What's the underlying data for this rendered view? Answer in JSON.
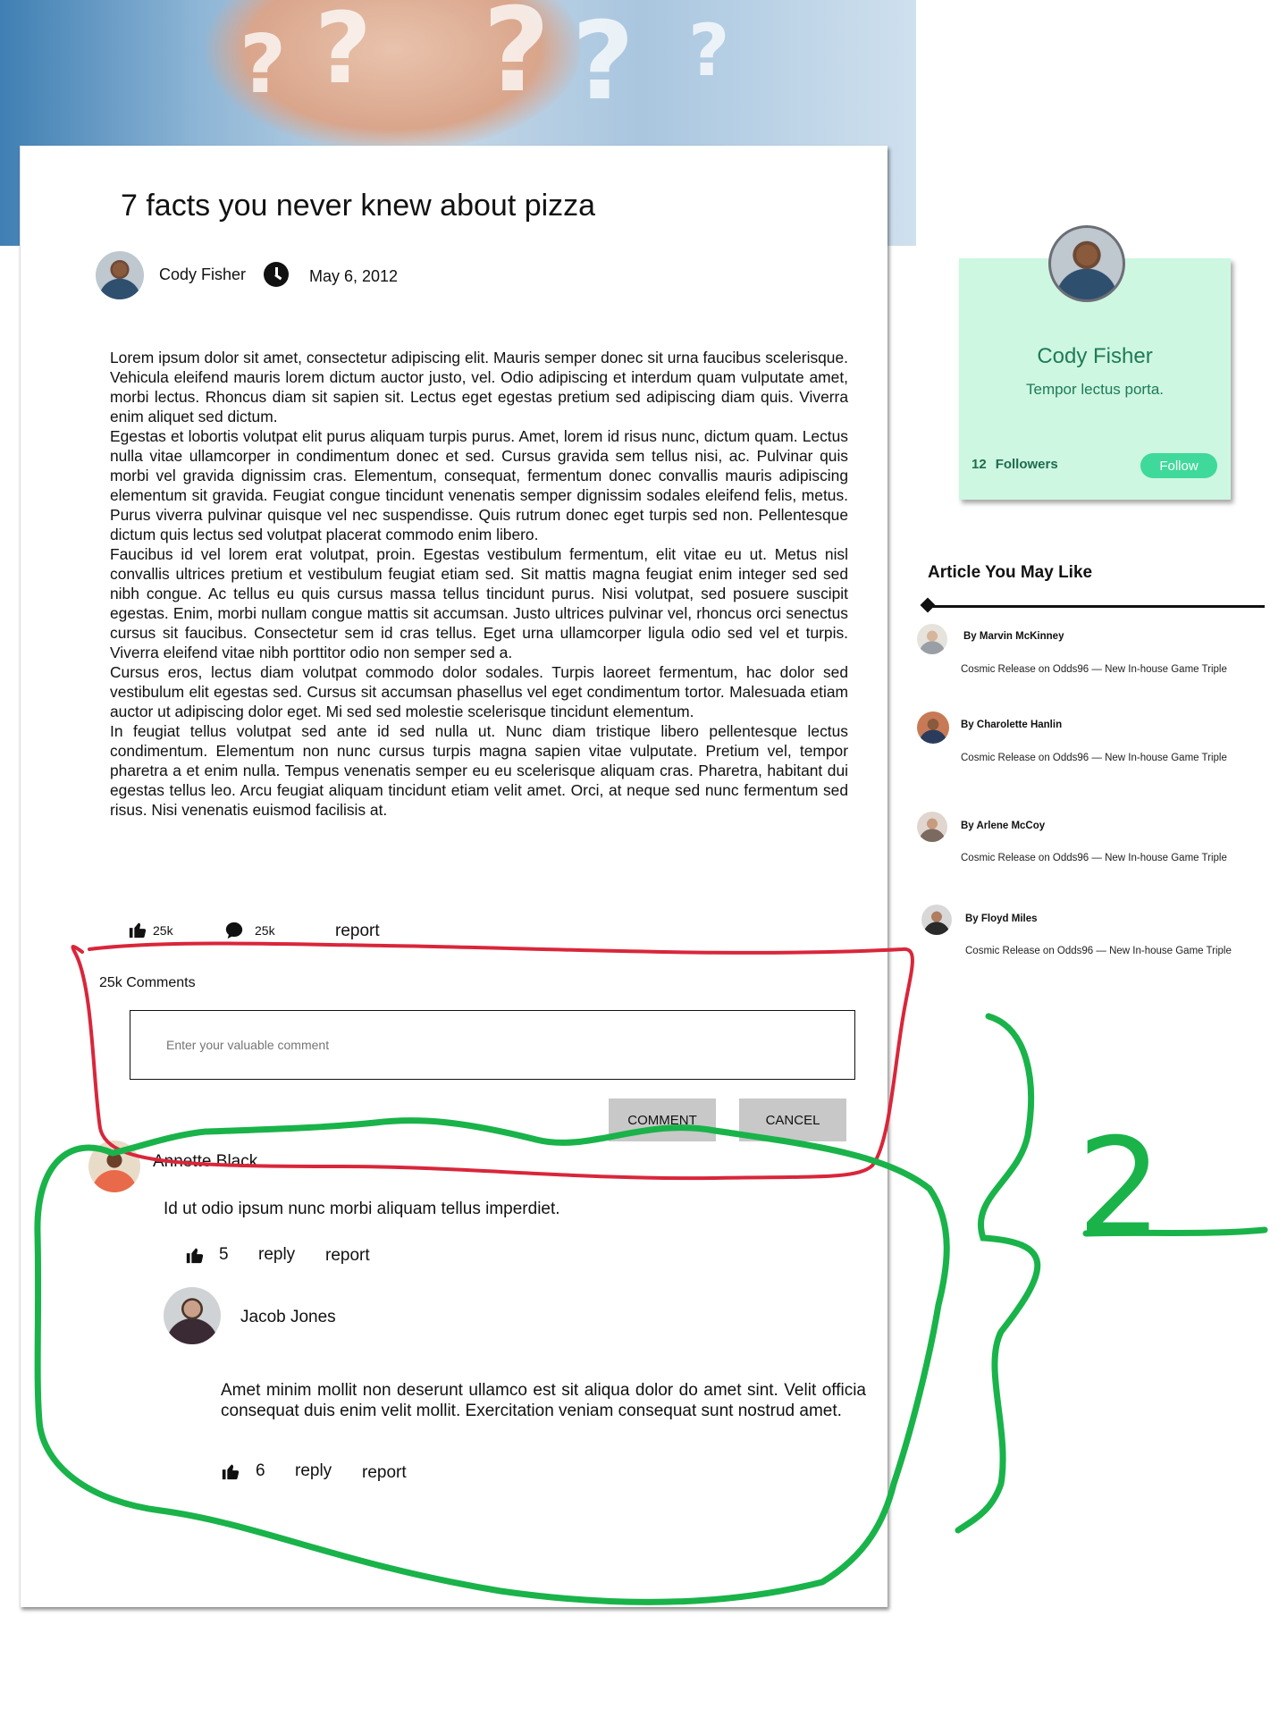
{
  "article": {
    "title": "7 facts you never knew about pizza",
    "author": "Cody Fisher",
    "date": "May 6, 2012",
    "paragraphs": [
      "Lorem ipsum dolor sit amet, consectetur adipiscing elit. Mauris semper donec sit urna faucibus scelerisque. Vehicula eleifend mauris lorem dictum auctor justo, vel. Odio adipiscing et interdum quam vulputate amet, morbi lectus. Rhoncus diam sit sapien sit. Lectus eget egestas pretium sed adipiscing diam quis. Viverra enim aliquet sed dictum.",
      "Egestas et lobortis volutpat elit purus aliquam turpis purus. Amet, lorem id risus nunc, dictum quam. Lectus nulla vitae ullamcorper in condimentum donec et sed. Cursus gravida sem tellus nisi, ac. Pulvinar quis morbi vel gravida dignissim cras. Elementum, consequat, fermentum donec convallis mauris adipiscing elementum sit gravida. Feugiat congue tincidunt venenatis semper dignissim sodales eleifend felis, metus. Purus viverra pulvinar quisque vel nec suspendisse. Quis rutrum donec eget turpis sed non. Pellentesque dictum quis lectus sed volutpat placerat commodo enim libero.",
      "Faucibus id vel lorem erat volutpat, proin. Egestas vestibulum fermentum, elit vitae eu ut. Metus nisl convallis ultrices pretium et vestibulum feugiat etiam sed. Sit mattis magna feugiat enim integer sed sed nibh congue. Ac tellus eu quis cursus massa tellus tincidunt purus. Nisi volutpat, sed posuere suscipit egestas. Enim, morbi nullam congue mattis sit accumsan. Justo ultrices pulvinar vel, rhoncus orci senectus cursus sit faucibus. Consectetur sem id cras tellus. Eget urna ullamcorper ligula odio sed vel et turpis. Viverra eleifend vitae nibh porttitor odio non semper sed a.",
      "Cursus eros, lectus diam volutpat commodo dolor sodales. Turpis laoreet fermentum, hac dolor sed vestibulum elit egestas sed. Cursus sit accumsan phasellus vel eget condimentum tortor. Malesuada etiam auctor ut adipiscing dolor eget. Mi sed sed molestie scelerisque tincidunt elementum.",
      "In feugiat tellus volutpat sed ante id sed nulla ut. Nunc diam tristique libero pellentesque lectus condimentum. Elementum non nunc cursus turpis magna sapien vitae vulputate. Pretium vel, tempor pharetra a et enim nulla. Tempus venenatis semper eu eu scelerisque aliquam cras. Pharetra, habitant dui egestas tellus leo. Arcu feugiat aliquam tincidunt etiam velit amet. Orci, at neque sed nunc fermentum sed risus. Nisi venenatis euismod facilisis at."
    ],
    "likes": "25k",
    "comments_count": "25k",
    "report_label": "report"
  },
  "comment_form": {
    "heading": "25k Comments",
    "placeholder": "Enter your valuable comment",
    "submit_label": "COMMENT",
    "cancel_label": "CANCEL"
  },
  "comments": [
    {
      "author": "Annette Black",
      "text": "Id ut odio ipsum nunc morbi aliquam tellus imperdiet.",
      "likes": "5",
      "reply_label": "reply",
      "report_label": "report",
      "replies": [
        {
          "author": "Jacob Jones",
          "text": "Amet minim mollit non deserunt ullamco est sit aliqua dolor do amet sint. Velit officia consequat duis enim velit mollit. Exercitation veniam consequat sunt nostrud amet.",
          "likes": "6",
          "reply_label": "reply",
          "report_label": "report"
        }
      ]
    }
  ],
  "author_card": {
    "name": "Cody Fisher",
    "tagline": "Tempor lectus porta.",
    "followers_count": "12",
    "followers_label": "Followers",
    "follow_label": "Follow"
  },
  "sidebar": {
    "title": "Article You May Like",
    "items": [
      {
        "by": "By Marvin McKinney",
        "desc": "Cosmic Release on Odds96 — New In-house Game Triple"
      },
      {
        "by": "By Charolette Hanlin",
        "desc": "Cosmic Release on Odds96 — New In-house Game Triple"
      },
      {
        "by": "By Arlene McCoy",
        "desc": "Cosmic Release on Odds96 — New In-house Game Triple"
      },
      {
        "by": "By Floyd Miles",
        "desc": "Cosmic Release on Odds96 — New In-house Game Triple"
      }
    ]
  },
  "annotations": {
    "number_label": "2",
    "red_color": "#d9263a",
    "green_color": "#19b34a"
  },
  "colors": {
    "author_card_bg": "#cdf7e1",
    "author_text": "#1f7a58",
    "follow_button": "#3fd99b",
    "button_gray": "#c8c8c8"
  }
}
